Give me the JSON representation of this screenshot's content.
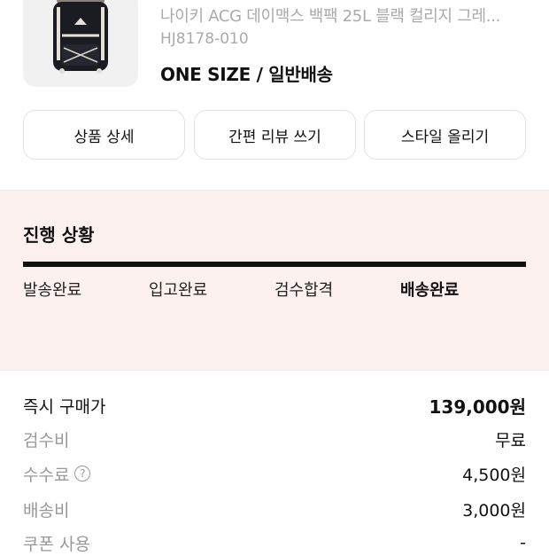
{
  "product": {
    "name": "나이키 ACG 데이맥스 백팩 25L 블랙 컬리지 그레...",
    "code": "HJ8178-010",
    "size_shipping": "ONE SIZE / 일반배송"
  },
  "actions": [
    {
      "label": "상품 상세"
    },
    {
      "label": "간편 리뷰 쓰기"
    },
    {
      "label": "스타일 올리기"
    }
  ],
  "progress": {
    "title": "진행 상황",
    "steps": [
      "발송완료",
      "입고완료",
      "검수합격",
      "배송완료"
    ],
    "current_step": "배송완료",
    "fill": 1.0,
    "bar_color": "#111111",
    "background": "#fdf1f0"
  },
  "price": {
    "rows": [
      {
        "label": "즉시 구매가",
        "value": "139,000원"
      },
      {
        "label": "검수비",
        "value": "무료"
      },
      {
        "label": "수수료",
        "value": "4,500원",
        "help_glyph": "?"
      },
      {
        "label": "배송비",
        "value": "3,000원"
      },
      {
        "label": "쿠폰 사용",
        "value": "-"
      }
    ]
  }
}
